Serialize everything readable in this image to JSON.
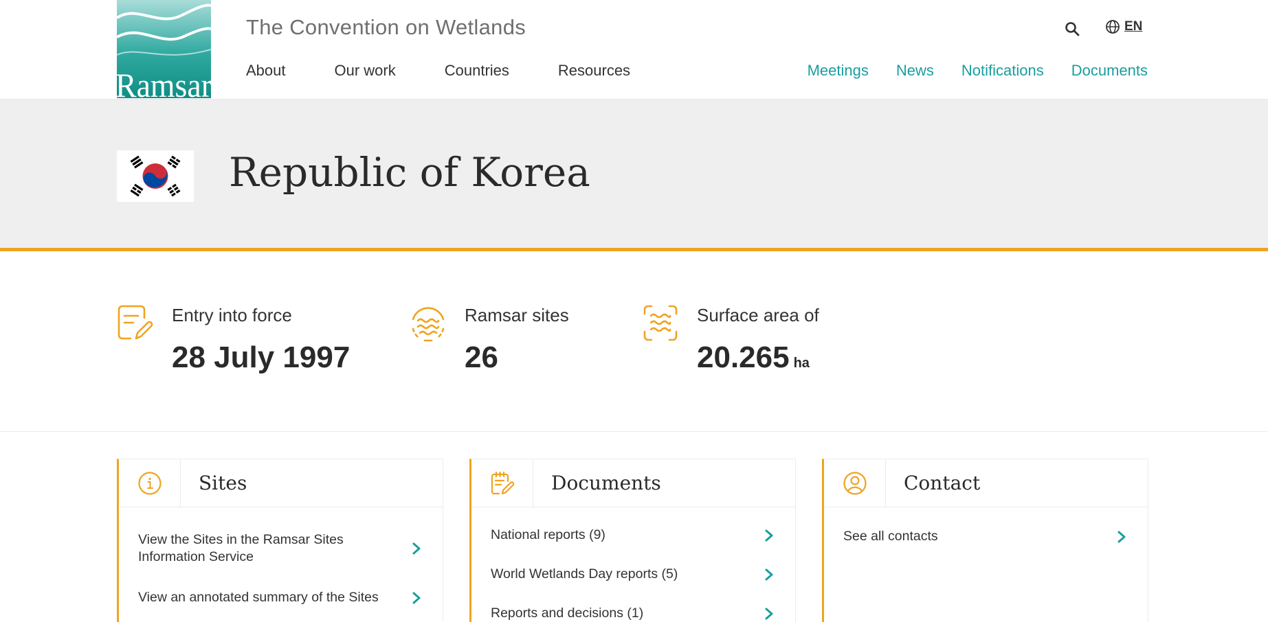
{
  "header": {
    "logo_text": "Ramsar",
    "tagline": "The Convention on Wetlands",
    "main_nav": [
      "About",
      "Our work",
      "Countries",
      "Resources"
    ],
    "secondary_nav": [
      "Meetings",
      "News",
      "Notifications",
      "Documents"
    ],
    "language": "EN",
    "search_icon": "search-icon",
    "globe_icon": "globe-icon"
  },
  "hero": {
    "country": "Republic of Korea",
    "flag": "south-korea-flag"
  },
  "stats": [
    {
      "label": "Entry into force",
      "value": "28 July 1997",
      "unit": "",
      "icon": "document-edit-icon"
    },
    {
      "label": "Ramsar sites",
      "value": "26",
      "unit": "",
      "icon": "wetland-waves-icon"
    },
    {
      "label": "Surface area of",
      "value": "20.265",
      "unit": "ha",
      "icon": "area-waves-icon"
    }
  ],
  "cards": {
    "sites": {
      "title": "Sites",
      "icon": "info-icon",
      "links": [
        "View the Sites in the Ramsar Sites Information Service",
        "View an annotated summary of the Sites"
      ]
    },
    "documents": {
      "title": "Documents",
      "icon": "document-calendar-icon",
      "links": [
        "National reports (9)",
        "World Wetlands Day reports (5)",
        "Reports and decisions (1)"
      ]
    },
    "contact": {
      "title": "Contact",
      "icon": "user-icon",
      "links": [
        "See all contacts"
      ]
    }
  },
  "colors": {
    "accent_orange": "#f0a31e",
    "accent_teal": "#1a9e9e",
    "hero_bg": "#efefef",
    "text_dark": "#2a2a2a"
  }
}
